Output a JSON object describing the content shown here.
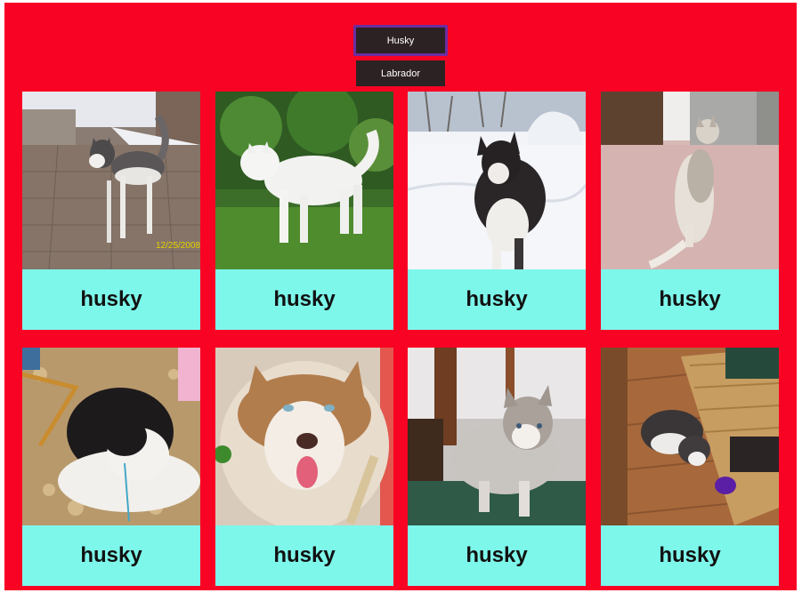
{
  "filters": {
    "husky_label": "Husky",
    "labrador_label": "Labrador"
  },
  "colors": {
    "frame_background": "#f80324",
    "button_background": "#2d2223",
    "active_button_border": "#6b2ea0",
    "caption_background": "#7ef7eb"
  },
  "cards": [
    {
      "caption": "husky",
      "photo": "husky-on-brick-patio-photo",
      "photo_timestamp": "12/25/2008"
    },
    {
      "caption": "husky",
      "photo": "white-husky-on-grass-photo"
    },
    {
      "caption": "husky",
      "photo": "husky-in-snow-photo"
    },
    {
      "caption": "husky",
      "photo": "husky-sitting-indoors-photo"
    },
    {
      "caption": "husky",
      "photo": "black-white-husky-lying-photo"
    },
    {
      "caption": "husky",
      "photo": "red-husky-closeup-photo"
    },
    {
      "caption": "husky",
      "photo": "grey-husky-puppy-photo"
    },
    {
      "caption": "husky",
      "photo": "husky-puppy-under-wicker-table-photo"
    }
  ]
}
